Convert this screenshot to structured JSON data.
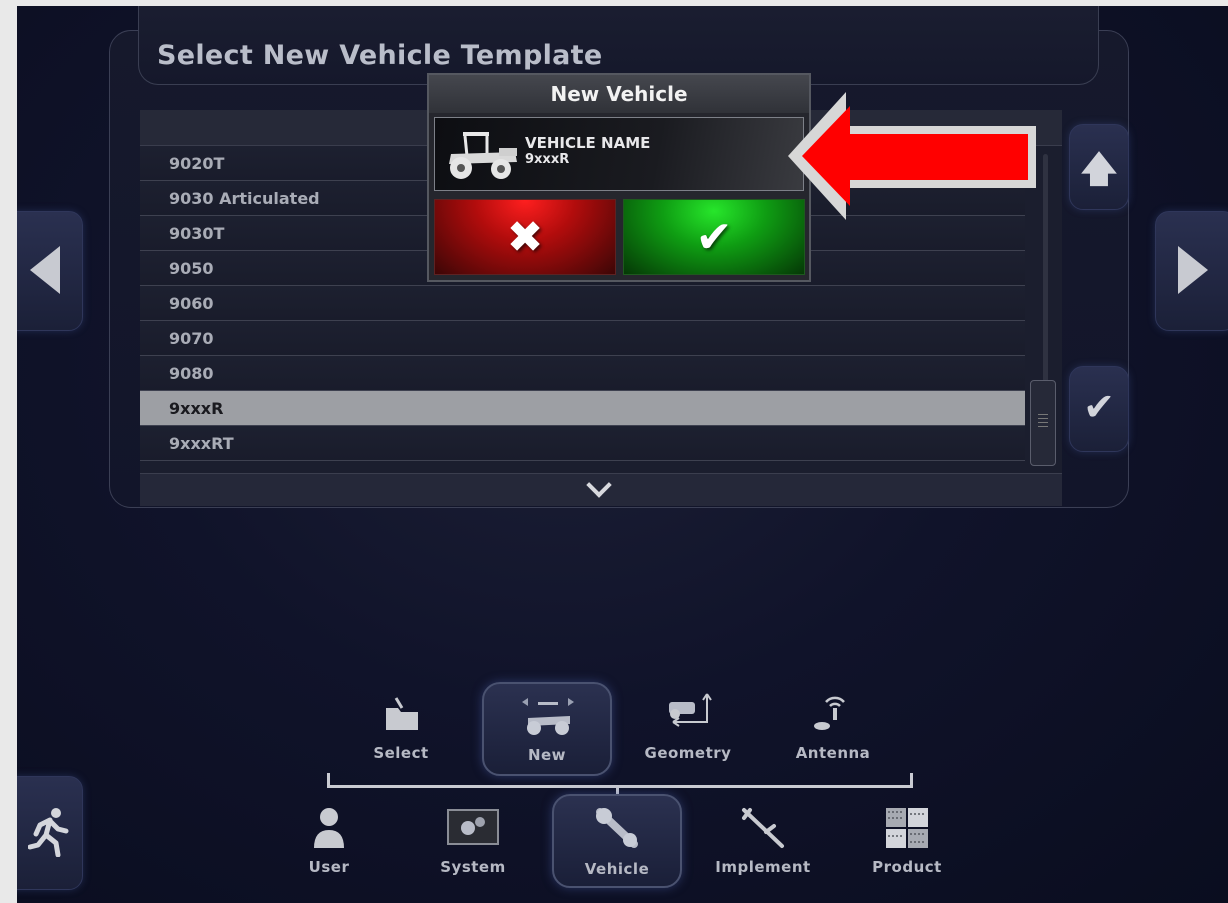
{
  "title": "Select New Vehicle Template",
  "list": {
    "rows": [
      {
        "label": "9020T",
        "selected": false
      },
      {
        "label": "9030 Articulated",
        "selected": false
      },
      {
        "label": "9030T",
        "selected": false
      },
      {
        "label": "9050",
        "selected": false
      },
      {
        "label": "9060",
        "selected": false
      },
      {
        "label": "9070",
        "selected": false
      },
      {
        "label": "9080",
        "selected": false
      },
      {
        "label": "9xxxR",
        "selected": true
      },
      {
        "label": "9xxxRT",
        "selected": false
      }
    ]
  },
  "modal": {
    "title": "New Vehicle",
    "field_label": "VEHICLE NAME",
    "field_value": "9xxxR",
    "cancel_glyph": "✖",
    "ok_glyph": "✔"
  },
  "side_buttons": {
    "scroll_up_glyph": "🡅",
    "confirm_glyph": "✔"
  },
  "subnav": {
    "items": [
      {
        "label": "Select",
        "icon": "folder-icon",
        "active": false
      },
      {
        "label": "New",
        "icon": "tractor-icon",
        "active": true
      },
      {
        "label": "Geometry",
        "icon": "geometry-icon",
        "active": false
      },
      {
        "label": "Antenna",
        "icon": "antenna-icon",
        "active": false
      }
    ]
  },
  "mainnav": {
    "items": [
      {
        "label": "User",
        "icon": "user-icon",
        "active": false
      },
      {
        "label": "System",
        "icon": "system-gears-icon",
        "active": false
      },
      {
        "label": "Vehicle",
        "icon": "vehicle-wrench-icon",
        "active": true
      },
      {
        "label": "Implement",
        "icon": "implement-icon",
        "active": false
      },
      {
        "label": "Product",
        "icon": "product-icon",
        "active": false
      }
    ]
  },
  "colors": {
    "accent_red": "#ff0000",
    "cancel": "#c41010",
    "ok": "#13a818",
    "selected_row": "#9d9fa4"
  }
}
